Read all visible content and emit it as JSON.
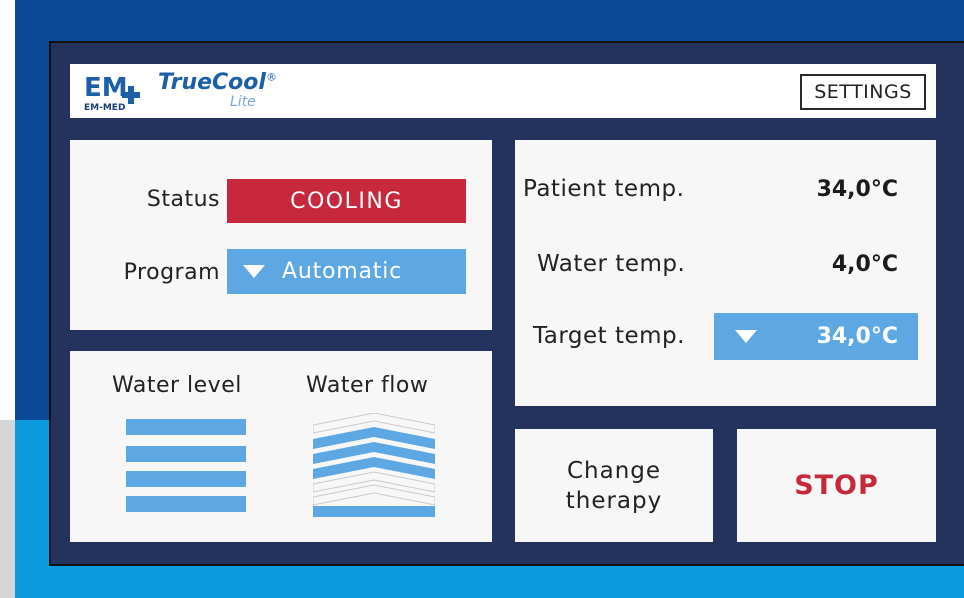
{
  "brand": {
    "logo_text": "EM-MED",
    "name": "TrueCool",
    "registered": "®",
    "edition": "Lite"
  },
  "header": {
    "settings_label": "SETTINGS"
  },
  "status_panel": {
    "status_label": "Status",
    "status_value": "COOLING",
    "program_label": "Program",
    "program_value": "Automatic"
  },
  "temps": {
    "patient_label": "Patient temp.",
    "patient_value": "34,0°C",
    "water_label": "Water temp.",
    "water_value": "4,0°C",
    "target_label": "Target temp.",
    "target_value": "34,0°C"
  },
  "levels": {
    "water_level_label": "Water level",
    "water_level_bars_filled": 4,
    "water_level_bars_total": 4,
    "water_flow_label": "Water flow",
    "water_flow_chevrons_filled": 4,
    "water_flow_chevrons_total": 7
  },
  "actions": {
    "change_line1": "Change",
    "change_line2": "therapy",
    "stop_label": "STOP"
  },
  "colors": {
    "frame": "#23335e",
    "accent_blue": "#5da8e2",
    "alert_red": "#c8283c",
    "brand_blue": "#1b5fa9"
  }
}
